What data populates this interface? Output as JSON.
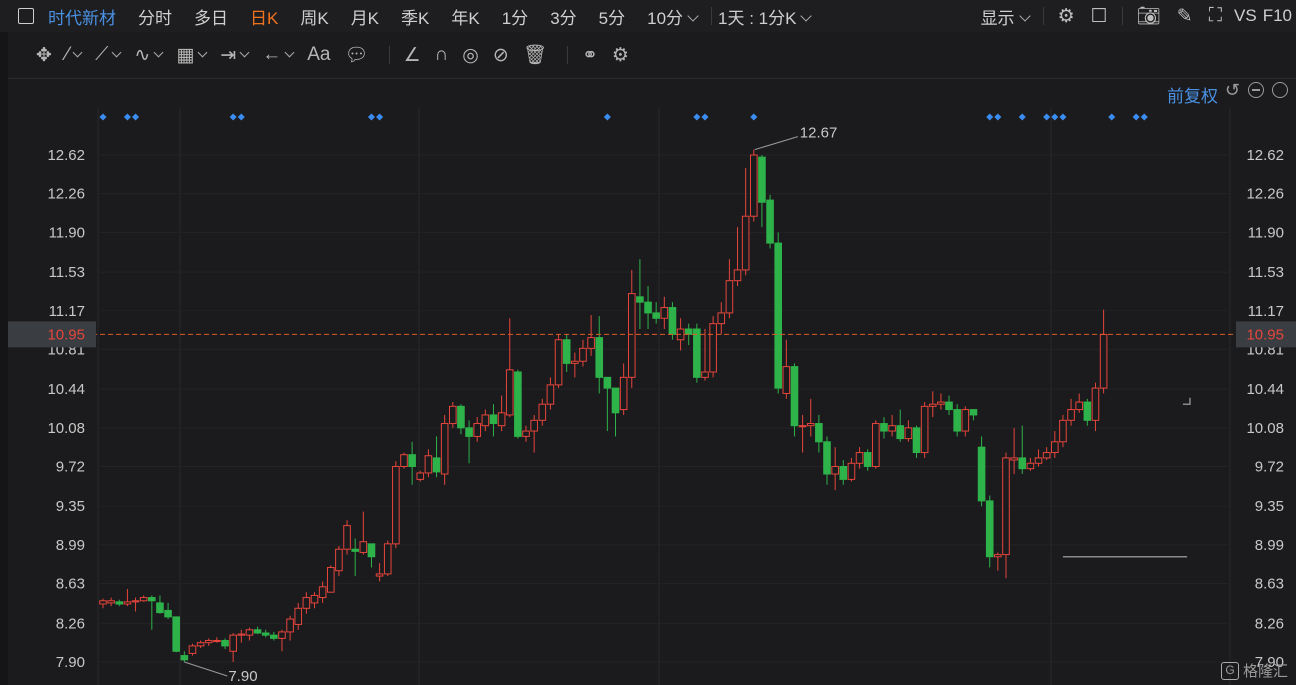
{
  "header": {
    "title": "时代新材",
    "tabs": [
      "分时",
      "多日",
      "日K",
      "周K",
      "月K",
      "季K",
      "年K",
      "1分",
      "3分",
      "5分",
      "10分"
    ],
    "active_tab": "日K",
    "period_select": "1天 : 1分K",
    "display_label": "显示",
    "vs_label": "VS",
    "f10_label": "F10"
  },
  "drawing_tools": [
    "move-icon",
    "line-icon",
    "polyline-icon",
    "wave-icon",
    "fib-icon",
    "range-icon",
    "arrow-icon",
    "text-icon",
    "comment-icon",
    "ruler-icon",
    "magnet-icon",
    "lock-eye-icon",
    "hide-icon",
    "trash-icon",
    "link-icon",
    "settings-icon"
  ],
  "text_tool_label": "Aa",
  "adjust": {
    "label": "前复权"
  },
  "price_axis": {
    "ticks": [
      "12.62",
      "12.26",
      "11.90",
      "11.53",
      "11.17",
      "10.81",
      "10.44",
      "10.08",
      "9.72",
      "9.35",
      "8.99",
      "8.63",
      "8.26",
      "7.90"
    ]
  },
  "current_price": "10.95",
  "annotations": {
    "high": "12.67",
    "low": "7.90"
  },
  "logo_text": "格隆汇",
  "colors": {
    "up": "#e6453c",
    "down": "#2eb24a",
    "accent": "#4a90e2",
    "active_tab": "#f0721f",
    "marker": "#3b8cf0"
  },
  "chart_data": {
    "type": "candlestick",
    "ylim": [
      7.9,
      12.62
    ],
    "candles": [
      [
        8.44,
        8.47,
        8.4,
        8.49
      ],
      [
        8.45,
        8.47,
        8.42,
        8.5
      ],
      [
        8.46,
        8.44,
        8.42,
        8.48
      ],
      [
        8.44,
        8.46,
        8.42,
        8.58
      ],
      [
        8.46,
        8.47,
        8.37,
        8.5
      ],
      [
        8.47,
        8.5,
        8.46,
        8.52
      ],
      [
        8.5,
        8.47,
        8.2,
        8.52
      ],
      [
        8.45,
        8.36,
        8.35,
        8.52
      ],
      [
        8.38,
        8.32,
        8.3,
        8.45
      ],
      [
        8.32,
        8.0,
        7.99,
        8.32
      ],
      [
        7.96,
        7.92,
        7.9,
        8.0
      ],
      [
        7.98,
        8.05,
        7.96,
        8.07
      ],
      [
        8.05,
        8.08,
        8.03,
        8.1
      ],
      [
        8.08,
        8.1,
        8.05,
        8.12
      ],
      [
        8.1,
        8.1,
        8.08,
        8.13
      ],
      [
        8.1,
        8.05,
        8.02,
        8.12
      ],
      [
        8.0,
        8.15,
        7.9,
        8.17
      ],
      [
        8.15,
        8.16,
        8.08,
        8.2
      ],
      [
        8.15,
        8.2,
        8.1,
        8.22
      ],
      [
        8.2,
        8.17,
        8.16,
        8.23
      ],
      [
        8.17,
        8.15,
        8.13,
        8.2
      ],
      [
        8.15,
        8.12,
        8.1,
        8.18
      ],
      [
        8.12,
        8.18,
        8.0,
        8.2
      ],
      [
        8.18,
        8.3,
        8.1,
        8.33
      ],
      [
        8.25,
        8.4,
        8.2,
        8.45
      ],
      [
        8.4,
        8.5,
        8.35,
        8.55
      ],
      [
        8.45,
        8.52,
        8.4,
        8.55
      ],
      [
        8.5,
        8.6,
        8.45,
        8.65
      ],
      [
        8.55,
        8.78,
        8.55,
        8.8
      ],
      [
        8.75,
        8.95,
        8.7,
        8.98
      ],
      [
        8.95,
        9.17,
        8.9,
        9.22
      ],
      [
        8.95,
        8.93,
        8.7,
        9.05
      ],
      [
        8.92,
        9.02,
        8.9,
        9.3
      ],
      [
        9.0,
        8.88,
        8.78,
        9.0
      ],
      [
        8.7,
        8.72,
        8.65,
        8.82
      ],
      [
        8.72,
        9.0,
        8.7,
        9.03
      ],
      [
        9.0,
        9.72,
        8.96,
        9.77
      ],
      [
        9.72,
        9.83,
        9.7,
        9.85
      ],
      [
        9.83,
        9.72,
        9.55,
        9.95
      ],
      [
        9.6,
        9.66,
        9.58,
        9.68
      ],
      [
        9.66,
        9.82,
        9.62,
        9.88
      ],
      [
        9.8,
        9.67,
        9.62,
        10.0
      ],
      [
        9.65,
        10.12,
        9.55,
        10.2
      ],
      [
        10.12,
        10.28,
        10.08,
        10.32
      ],
      [
        10.28,
        10.08,
        10.02,
        10.3
      ],
      [
        10.08,
        10.0,
        9.75,
        10.15
      ],
      [
        10.0,
        10.12,
        9.95,
        10.18
      ],
      [
        10.1,
        10.2,
        10.05,
        10.25
      ],
      [
        10.2,
        10.12,
        10.0,
        10.3
      ],
      [
        10.1,
        10.22,
        10.05,
        10.38
      ],
      [
        10.2,
        10.62,
        10.18,
        11.1
      ],
      [
        10.6,
        10.0,
        9.98,
        10.62
      ],
      [
        10.0,
        10.05,
        9.95,
        10.1
      ],
      [
        10.05,
        10.15,
        9.85,
        10.2
      ],
      [
        10.15,
        10.3,
        10.1,
        10.35
      ],
      [
        10.3,
        10.48,
        10.25,
        10.55
      ],
      [
        10.48,
        10.9,
        10.45,
        10.95
      ],
      [
        10.9,
        10.68,
        10.6,
        10.95
      ],
      [
        10.68,
        10.7,
        10.55,
        10.78
      ],
      [
        10.7,
        10.82,
        10.65,
        10.9
      ],
      [
        10.82,
        10.92,
        10.75,
        11.13
      ],
      [
        10.92,
        10.55,
        10.4,
        11.12
      ],
      [
        10.55,
        10.45,
        10.05,
        10.55
      ],
      [
        10.45,
        10.22,
        10.0,
        10.45
      ],
      [
        10.25,
        10.55,
        10.2,
        10.68
      ],
      [
        10.55,
        11.33,
        10.45,
        11.55
      ],
      [
        11.3,
        11.25,
        11.0,
        11.65
      ],
      [
        11.25,
        11.15,
        11.0,
        11.4
      ],
      [
        11.15,
        11.1,
        11.05,
        11.25
      ],
      [
        11.1,
        11.2,
        11.0,
        11.3
      ],
      [
        11.2,
        10.95,
        10.9,
        11.25
      ],
      [
        10.9,
        11.0,
        10.8,
        11.1
      ],
      [
        11.0,
        10.95,
        10.85,
        11.05
      ],
      [
        11.0,
        10.55,
        10.5,
        11.05
      ],
      [
        10.55,
        10.6,
        10.52,
        11.0
      ],
      [
        10.6,
        11.05,
        10.55,
        11.12
      ],
      [
        11.05,
        11.15,
        10.95,
        11.25
      ],
      [
        11.15,
        11.45,
        11.1,
        11.65
      ],
      [
        11.45,
        11.55,
        11.4,
        11.95
      ],
      [
        11.55,
        12.05,
        11.5,
        12.5
      ],
      [
        12.05,
        12.62,
        12.0,
        12.67
      ],
      [
        12.6,
        12.18,
        11.95,
        12.62
      ],
      [
        12.2,
        11.8,
        11.75,
        12.25
      ],
      [
        11.8,
        10.45,
        10.4,
        11.9
      ],
      [
        10.4,
        10.65,
        10.35,
        10.9
      ],
      [
        10.65,
        10.1,
        10.0,
        10.68
      ],
      [
        10.1,
        10.1,
        9.85,
        10.2
      ],
      [
        10.1,
        10.12,
        10.0,
        10.35
      ],
      [
        10.12,
        9.95,
        9.85,
        10.2
      ],
      [
        9.95,
        9.65,
        9.55,
        10.0
      ],
      [
        9.65,
        9.72,
        9.5,
        9.9
      ],
      [
        9.72,
        9.6,
        9.55,
        9.78
      ],
      [
        9.6,
        9.75,
        9.58,
        9.8
      ],
      [
        9.75,
        9.85,
        9.7,
        9.9
      ],
      [
        9.85,
        9.72,
        9.68,
        9.88
      ],
      [
        9.72,
        10.12,
        9.7,
        10.15
      ],
      [
        10.12,
        10.05,
        9.98,
        10.18
      ],
      [
        10.05,
        10.1,
        10.0,
        10.2
      ],
      [
        10.1,
        9.98,
        9.95,
        10.25
      ],
      [
        9.98,
        10.08,
        9.95,
        10.15
      ],
      [
        10.08,
        9.85,
        9.8,
        10.1
      ],
      [
        9.85,
        10.28,
        9.8,
        10.32
      ],
      [
        10.28,
        10.3,
        10.18,
        10.42
      ],
      [
        10.3,
        10.32,
        10.25,
        10.4
      ],
      [
        10.32,
        10.25,
        10.2,
        10.38
      ],
      [
        10.25,
        10.05,
        10.0,
        10.3
      ],
      [
        10.05,
        10.25,
        10.0,
        10.28
      ],
      [
        10.25,
        10.2,
        10.15,
        10.25
      ],
      [
        9.9,
        9.4,
        9.35,
        10.0
      ],
      [
        9.4,
        8.88,
        8.78,
        9.45
      ],
      [
        8.88,
        8.9,
        8.75,
        8.92
      ],
      [
        8.9,
        9.8,
        8.68,
        9.85
      ],
      [
        9.78,
        9.8,
        9.65,
        10.08
      ],
      [
        9.8,
        9.7,
        9.65,
        10.1
      ],
      [
        9.7,
        9.75,
        9.68,
        9.8
      ],
      [
        9.75,
        9.8,
        9.72,
        9.88
      ],
      [
        9.8,
        9.85,
        9.78,
        9.9
      ],
      [
        9.85,
        9.95,
        9.8,
        10.05
      ],
      [
        9.95,
        10.15,
        9.9,
        10.2
      ],
      [
        10.15,
        10.25,
        10.1,
        10.35
      ],
      [
        10.25,
        10.32,
        10.22,
        10.4
      ],
      [
        10.32,
        10.15,
        10.1,
        10.35
      ],
      [
        10.15,
        10.45,
        10.05,
        10.5
      ],
      [
        10.45,
        10.95,
        10.4,
        11.18
      ]
    ],
    "markers_x": [
      0,
      3,
      4,
      16,
      17,
      33,
      34,
      62,
      73,
      74,
      80,
      109,
      110,
      113,
      116,
      117,
      118,
      124,
      127,
      128
    ],
    "low_guide": {
      "from_index": 118,
      "to_index": 134,
      "price": 8.88
    }
  }
}
